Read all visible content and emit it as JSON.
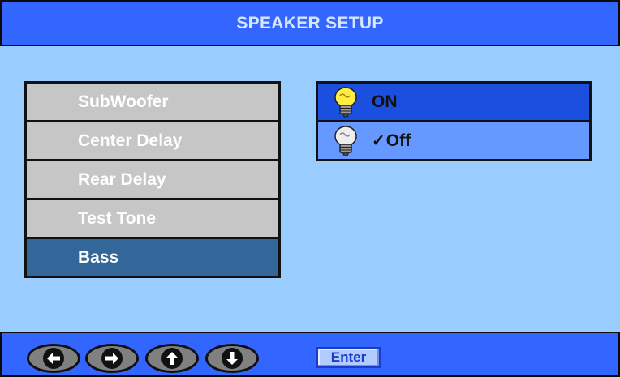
{
  "header": {
    "title": "SPEAKER SETUP"
  },
  "menu": {
    "items": [
      {
        "label": "SubWoofer"
      },
      {
        "label": "Center Delay"
      },
      {
        "label": "Rear Delay"
      },
      {
        "label": "Test Tone"
      },
      {
        "label": "Bass"
      }
    ],
    "selected_index": 4
  },
  "options": {
    "items": [
      {
        "label": "ON",
        "checked": false,
        "highlighted": true,
        "icon": "lightbulb-on-icon"
      },
      {
        "label": "Off",
        "checked": true,
        "highlighted": false,
        "icon": "lightbulb-off-icon"
      }
    ],
    "check_mark": "✓"
  },
  "footer": {
    "nav_buttons": [
      {
        "icon": "arrow-left-icon"
      },
      {
        "icon": "arrow-right-icon"
      },
      {
        "icon": "arrow-up-icon"
      },
      {
        "icon": "arrow-down-icon"
      }
    ],
    "enter_label": "Enter"
  },
  "colors": {
    "background": "#99ccff",
    "bar": "#3366ff",
    "menu_item": "#c6c6c6",
    "menu_selected": "#336699",
    "option_highlight": "#1a4fe0",
    "option_normal": "#6699ff"
  }
}
